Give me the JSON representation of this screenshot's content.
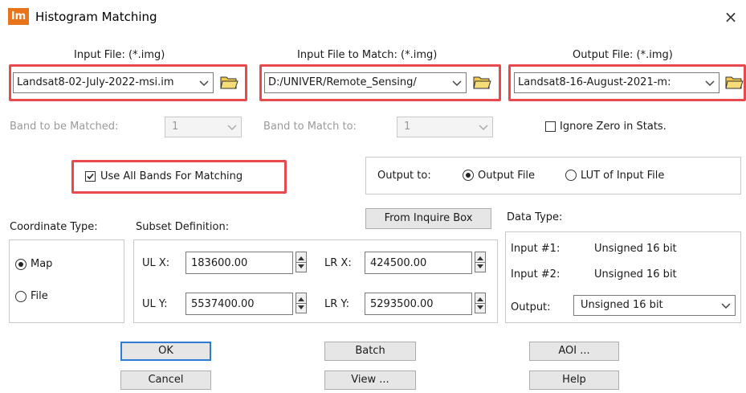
{
  "window": {
    "title": "Histogram Matching",
    "app_icon_text": "Im",
    "close_glyph": "×"
  },
  "files": {
    "input_label": "Input File: (*.img)",
    "input_value": "Landsat8-02-July-2022-msi.im",
    "match_label": "Input File to Match: (*.img)",
    "match_value": "D:/UNIVER/Remote_Sensing/",
    "output_label": "Output File: (*.img)",
    "output_value": "Landsat8-16-August-2021-m:"
  },
  "bands": {
    "band_matched_label": "Band to be Matched:",
    "band_matched_value": "1",
    "band_match_to_label": "Band to Match to:",
    "band_match_to_value": "1",
    "ignore_zero_label": "Ignore Zero in Stats.",
    "ignore_zero_checked": false
  },
  "use_all_bands": {
    "label": "Use All Bands For Matching",
    "checked": true
  },
  "output_to": {
    "label": "Output to:",
    "options": [
      "Output File",
      "LUT of Input File"
    ],
    "selected": "Output File"
  },
  "coordinate": {
    "label": "Coordinate Type:",
    "options": [
      "Map",
      "File"
    ],
    "selected": "Map"
  },
  "subset": {
    "label": "Subset Definition:",
    "inquire_button": "From Inquire Box",
    "ulx_label": "UL X:",
    "ulx_value": "183600.00",
    "uly_label": "UL Y:",
    "uly_value": "5537400.00",
    "lrx_label": "LR X:",
    "lrx_value": "424500.00",
    "lry_label": "LR Y:",
    "lry_value": "5293500.00"
  },
  "data_type": {
    "label": "Data Type:",
    "input1_label": "Input #1:",
    "input1_value": "Unsigned 16 bit",
    "input2_label": "Input #2:",
    "input2_value": "Unsigned 16 bit",
    "output_label": "Output:",
    "output_value": "Unsigned 16 bit"
  },
  "buttons": {
    "ok": "OK",
    "cancel": "Cancel",
    "batch": "Batch",
    "view": "View ...",
    "aoi": "AOI ...",
    "help": "Help"
  },
  "colors": {
    "highlight": "#e8494c",
    "app_icon": "#e8731b",
    "default_button_border": "#2c7cd6"
  },
  "icons": [
    "app-icon",
    "close-icon",
    "folder-open-icon",
    "chevron-down-icon",
    "spin-button-icon"
  ]
}
